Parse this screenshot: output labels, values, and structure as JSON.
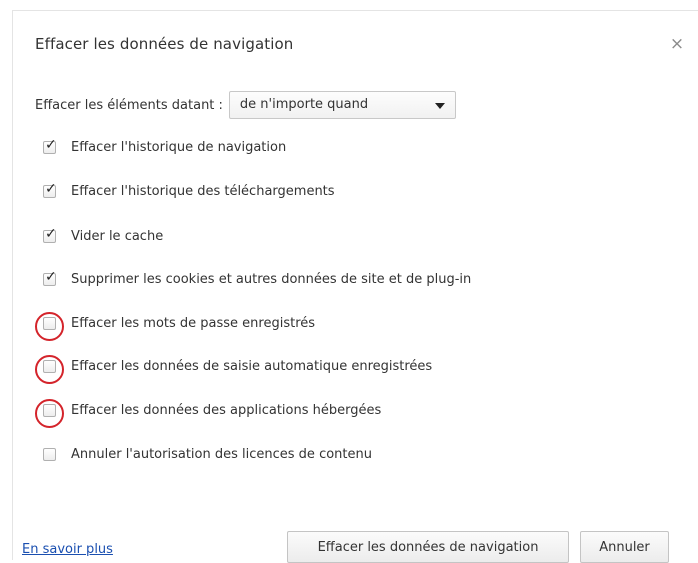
{
  "dialog": {
    "title": "Effacer les données de navigation",
    "close_icon": "close-icon"
  },
  "time_range": {
    "label": "Effacer les éléments datant :",
    "selected": "de n'importe quand"
  },
  "options": [
    {
      "label": "Effacer l'historique de navigation",
      "checked": true,
      "highlighted": false
    },
    {
      "label": "Effacer l'historique des téléchargements",
      "checked": true,
      "highlighted": false
    },
    {
      "label": "Vider le cache",
      "checked": true,
      "highlighted": false
    },
    {
      "label": "Supprimer les cookies et autres données de site et de plug-in",
      "checked": true,
      "highlighted": false
    },
    {
      "label": "Effacer les mots de passe enregistrés",
      "checked": false,
      "highlighted": true
    },
    {
      "label": "Effacer les données de saisie automatique enregistrées",
      "checked": false,
      "highlighted": true
    },
    {
      "label": "Effacer les données des applications hébergées",
      "checked": false,
      "highlighted": true
    },
    {
      "label": "Annuler l'autorisation des licences de contenu",
      "checked": false,
      "highlighted": false
    }
  ],
  "footer": {
    "learn_more": "En savoir plus",
    "clear_button": "Effacer les données de navigation",
    "cancel_button": "Annuler"
  },
  "colors": {
    "highlight_ring": "#d4242b",
    "link": "#1a4fb0"
  }
}
